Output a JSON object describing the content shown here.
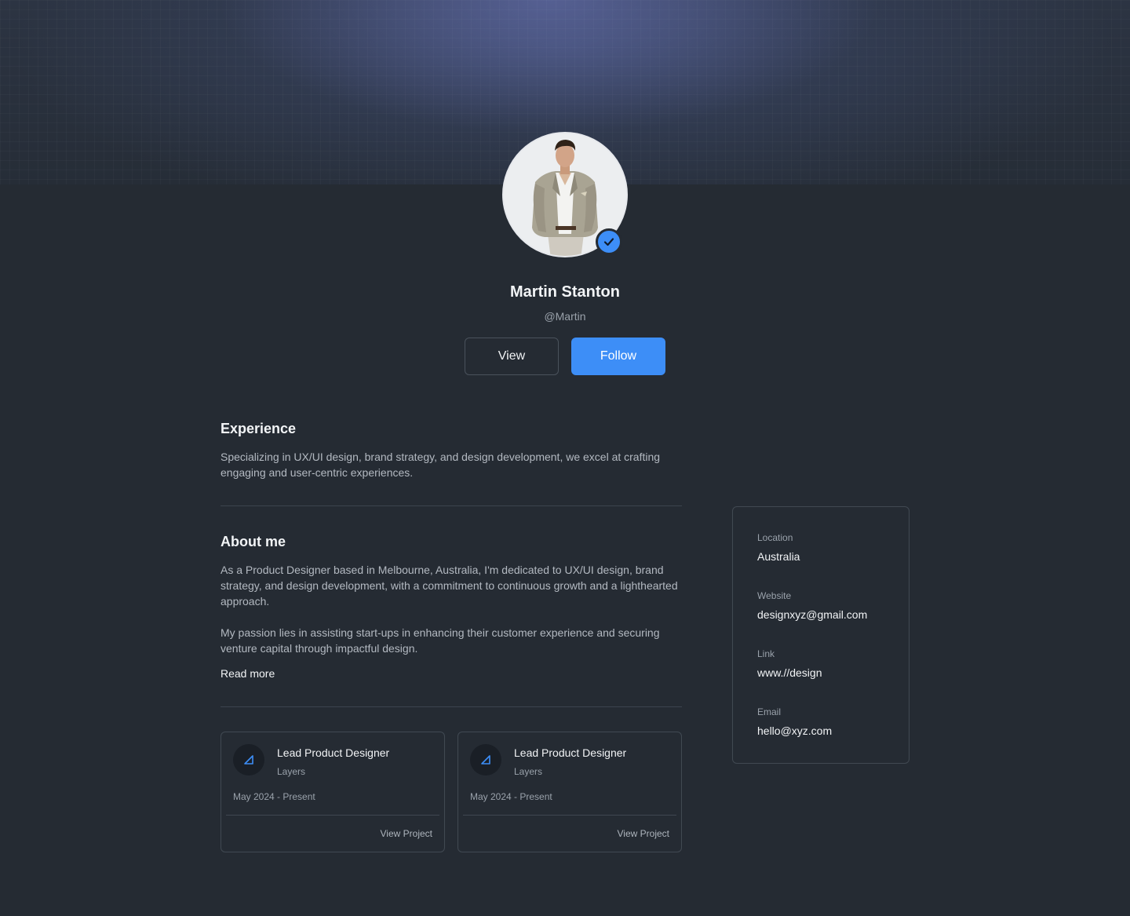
{
  "profile": {
    "name": "Martin Stanton",
    "handle": "@Martin",
    "view_label": "View",
    "follow_label": "Follow",
    "verified": true
  },
  "experience": {
    "heading": "Experience",
    "text": "Specializing in UX/UI design, brand strategy, and design development, we excel at crafting engaging and user-centric experiences."
  },
  "about": {
    "heading": "About me",
    "paragraph1": "As a Product Designer based in Melbourne, Australia, I'm dedicated to UX/UI design, brand strategy, and design development, with a commitment to continuous growth and a lighthearted approach.",
    "paragraph2": "My passion lies in assisting start-ups in enhancing their customer experience and securing venture capital through impactful design.",
    "read_more": "Read more"
  },
  "projects": [
    {
      "title": "Lead Product Designer",
      "company": "Layers",
      "dates": "May 2024 - Present",
      "link": "View Project"
    },
    {
      "title": "Lead Product Designer",
      "company": "Layers",
      "dates": "May 2024 - Present",
      "link": "View Project"
    }
  ],
  "info": {
    "location_label": "Location",
    "location_value": "Australia",
    "website_label": "Website",
    "website_value": "designxyz@gmail.com",
    "link_label": "Link",
    "link_value": "www.//design",
    "email_label": "Email",
    "email_value": "hello@xyz.com"
  },
  "colors": {
    "background": "#252b33",
    "accent": "#3d8ef7",
    "border": "#414952"
  }
}
